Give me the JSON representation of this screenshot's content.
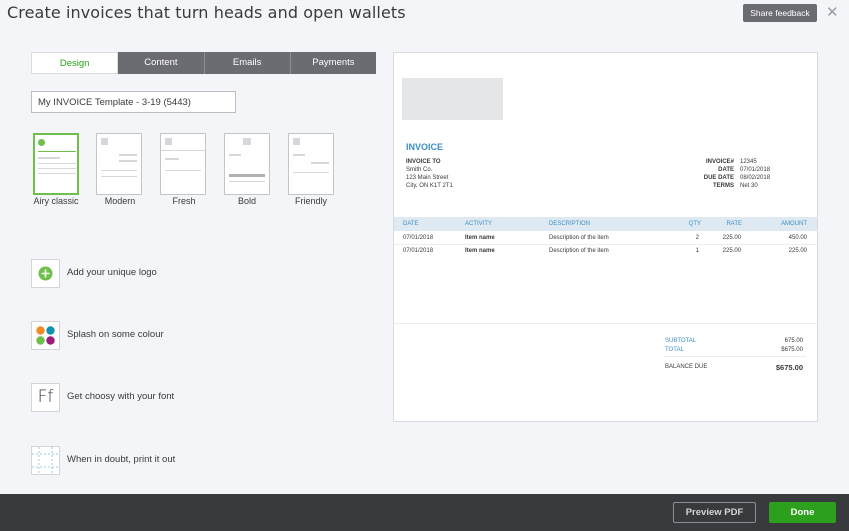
{
  "header": {
    "title": "Create invoices that turn heads and open wallets",
    "share_feedback": "Share feedback",
    "close_glyph": "✕"
  },
  "tabs": [
    {
      "label": "Design",
      "active": true
    },
    {
      "label": "Content",
      "active": false
    },
    {
      "label": "Emails",
      "active": false
    },
    {
      "label": "Payments",
      "active": false
    }
  ],
  "template_name": "My INVOICE Template - 3-19 (5443)",
  "styles": [
    {
      "label": "Airy classic",
      "selected": true
    },
    {
      "label": "Modern",
      "selected": false
    },
    {
      "label": "Fresh",
      "selected": false
    },
    {
      "label": "Bold",
      "selected": false
    },
    {
      "label": "Friendly",
      "selected": false
    }
  ],
  "options": [
    {
      "label": "Add your unique logo",
      "icon": "plus-circle-icon"
    },
    {
      "label": "Splash on some colour",
      "icon": "color-dots-icon"
    },
    {
      "label": "Get choosy with your font",
      "icon": "font-icon"
    },
    {
      "label": "When in doubt, print it out",
      "icon": "print-margins-icon"
    }
  ],
  "font_icon_text": "Ff",
  "colors": {
    "accent_green": "#2ca01c",
    "invoice_blue": "#3b8fc6",
    "dots": [
      "#f28c28",
      "#0f93b0",
      "#6fbf4a",
      "#9c1c7a"
    ]
  },
  "invoice": {
    "title": "INVOICE",
    "bill_to_label": "INVOICE TO",
    "customer": [
      "Smith Co.",
      "123 Main Street",
      "City, ON K1T 2T1"
    ],
    "meta": [
      {
        "label": "INVOICE#",
        "value": "12345"
      },
      {
        "label": "DATE",
        "value": "07/01/2018"
      },
      {
        "label": "DUE DATE",
        "value": "08/02/2018"
      },
      {
        "label": "TERMS",
        "value": "Net 30"
      }
    ],
    "columns": [
      "DATE",
      "ACTIVITY",
      "DESCRIPTION",
      "QTY",
      "RATE",
      "AMOUNT"
    ],
    "rows": [
      {
        "date": "07/01/2018",
        "activity": "Item name",
        "description": "Description of the item",
        "qty": "2",
        "rate": "225.00",
        "amount": "450.00"
      },
      {
        "date": "07/01/2018",
        "activity": "Item name",
        "description": "Description of the item",
        "qty": "1",
        "rate": "225.00",
        "amount": "225.00"
      }
    ],
    "subtotal_label": "SUBTOTAL",
    "subtotal": "675.00",
    "total_label": "TOTAL",
    "total": "$675.00",
    "balance_label": "BALANCE DUE",
    "balance": "$675.00"
  },
  "footer": {
    "preview_pdf": "Preview PDF",
    "done": "Done"
  }
}
